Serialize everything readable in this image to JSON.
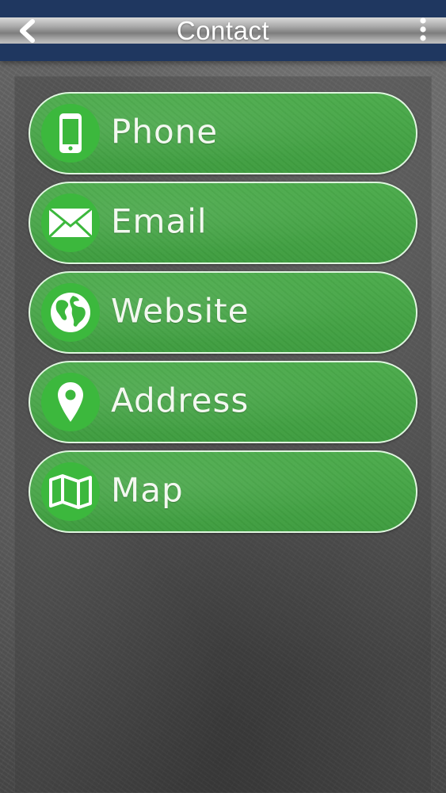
{
  "header": {
    "title": "Contact",
    "back_icon": "chevron-left-icon",
    "menu_icon": "more-vertical-icon"
  },
  "colors": {
    "header_navy": "#1f3760",
    "button_green": "#45a445",
    "icon_circle_green": "#3cb83d",
    "text_white": "#ffffff"
  },
  "contacts": [
    {
      "label": "Phone",
      "icon": "phone-icon"
    },
    {
      "label": "Email",
      "icon": "envelope-icon"
    },
    {
      "label": "Website",
      "icon": "globe-icon"
    },
    {
      "label": "Address",
      "icon": "map-pin-icon"
    },
    {
      "label": "Map",
      "icon": "map-icon"
    }
  ]
}
